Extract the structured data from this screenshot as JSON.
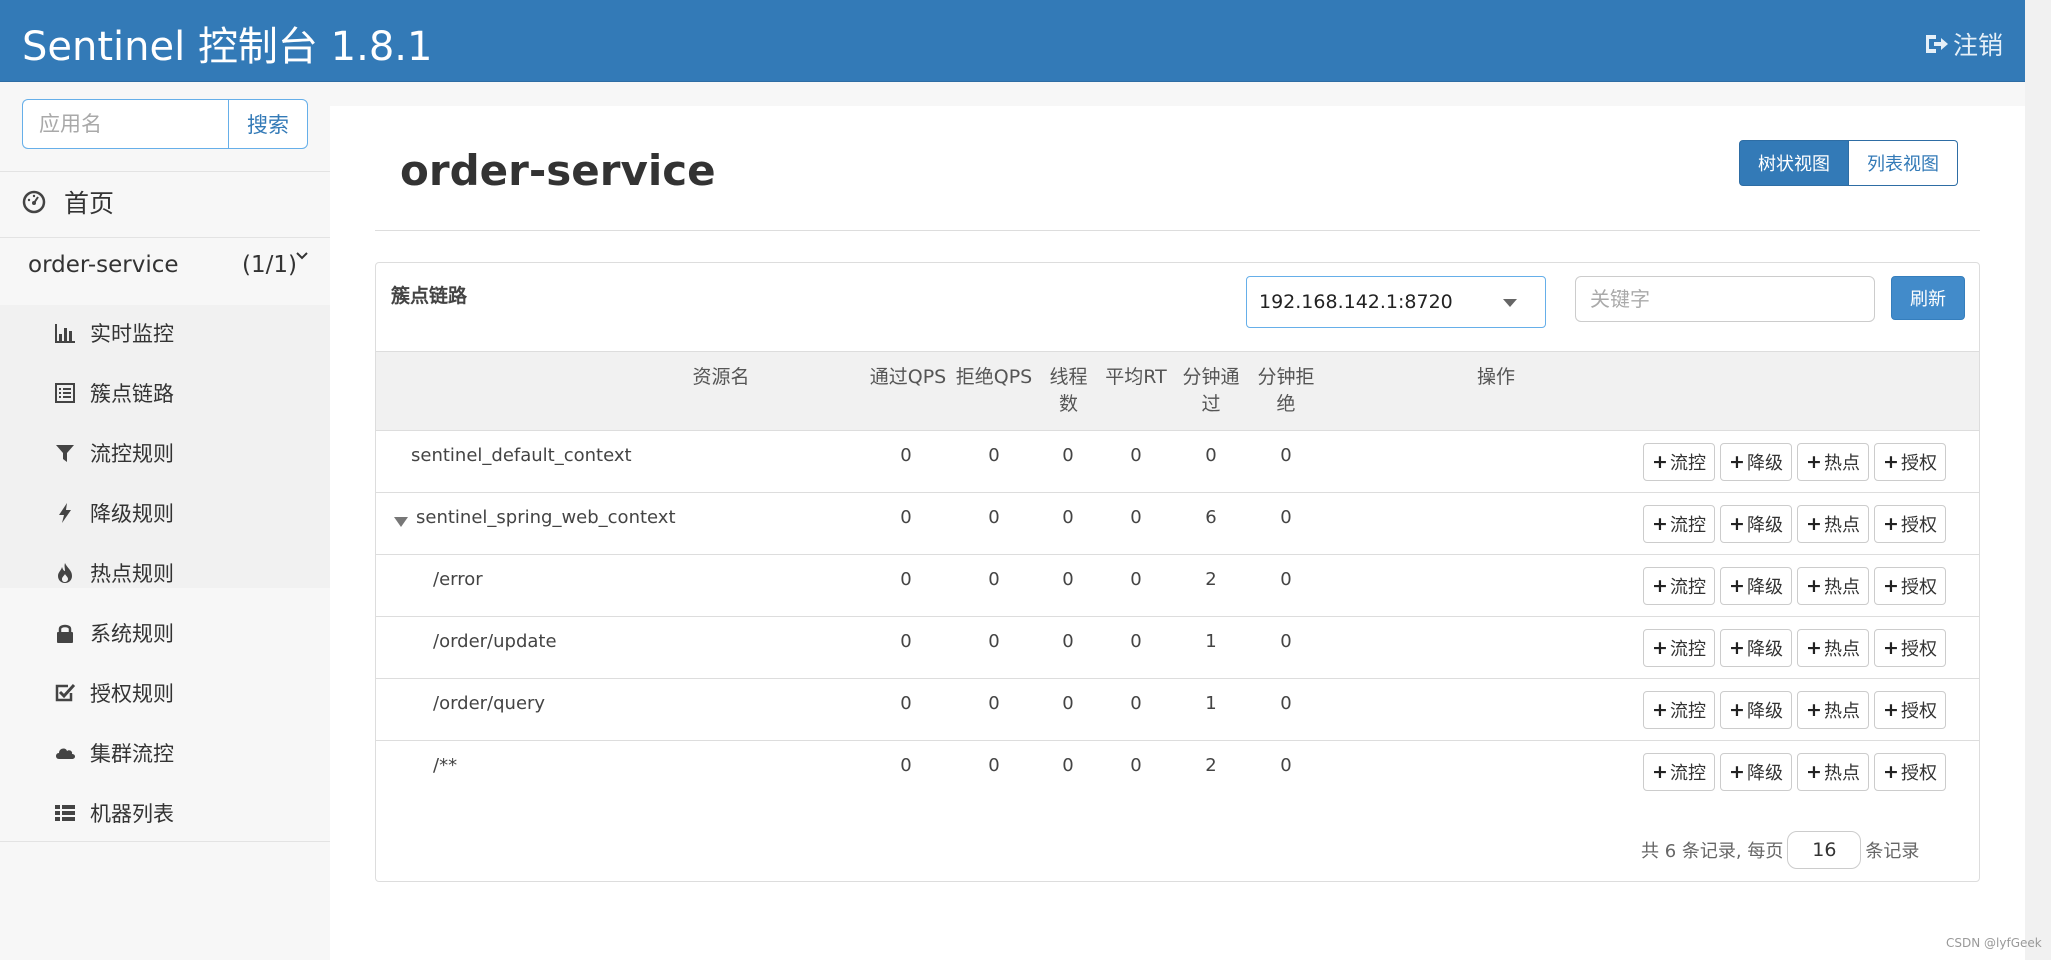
{
  "header": {
    "brand": "Sentinel 控制台 1.8.1",
    "logout_label": "注销"
  },
  "sidebar": {
    "search_placeholder": "应用名",
    "search_button": "搜索",
    "home_label": "首页",
    "app_name": "order-service",
    "app_count": "(1/1)",
    "menu_items": [
      {
        "label": "实时监控",
        "icon": "bar-chart-icon"
      },
      {
        "label": "簇点链路",
        "icon": "list-alt-icon"
      },
      {
        "label": "流控规则",
        "icon": "filter-icon"
      },
      {
        "label": "降级规则",
        "icon": "flash-icon"
      },
      {
        "label": "热点规则",
        "icon": "fire-icon"
      },
      {
        "label": "系统规则",
        "icon": "lock-icon"
      },
      {
        "label": "授权规则",
        "icon": "check-icon"
      },
      {
        "label": "集群流控",
        "icon": "cloud-icon"
      },
      {
        "label": "机器列表",
        "icon": "th-list-icon"
      }
    ]
  },
  "main": {
    "title": "order-service",
    "view_tree": "树状视图",
    "view_list": "列表视图",
    "panel_title": "簇点链路",
    "machine_value": "192.168.142.1:8720",
    "keyword_placeholder": "关键字",
    "refresh_label": "刷新",
    "columns": [
      "资源名",
      "通过QPS",
      "拒绝QPS",
      "线程数",
      "平均RT",
      "分钟通过",
      "分钟拒绝",
      "操作"
    ],
    "column_lines": {
      "thread": [
        "线程",
        "数"
      ],
      "min_pass": [
        "分钟通",
        "过"
      ],
      "min_block": [
        "分钟拒",
        "绝"
      ]
    },
    "rows": [
      {
        "name": "sentinel_default_context",
        "pass_qps": "0",
        "block_qps": "0",
        "threads": "0",
        "avg_rt": "0",
        "min_pass": "0",
        "min_block": "0"
      },
      {
        "name": "sentinel_spring_web_context",
        "pass_qps": "0",
        "block_qps": "0",
        "threads": "0",
        "avg_rt": "0",
        "min_pass": "6",
        "min_block": "0"
      },
      {
        "name": "/error",
        "pass_qps": "0",
        "block_qps": "0",
        "threads": "0",
        "avg_rt": "0",
        "min_pass": "2",
        "min_block": "0"
      },
      {
        "name": "/order/update",
        "pass_qps": "0",
        "block_qps": "0",
        "threads": "0",
        "avg_rt": "0",
        "min_pass": "1",
        "min_block": "0"
      },
      {
        "name": "/order/query",
        "pass_qps": "0",
        "block_qps": "0",
        "threads": "0",
        "avg_rt": "0",
        "min_pass": "1",
        "min_block": "0"
      },
      {
        "name": "/**",
        "pass_qps": "0",
        "block_qps": "0",
        "threads": "0",
        "avg_rt": "0",
        "min_pass": "2",
        "min_block": "0"
      }
    ],
    "op_buttons": [
      "流控",
      "降级",
      "热点",
      "授权"
    ],
    "pager_prefix": "共 6 条记录, 每页",
    "page_size": "16",
    "pager_suffix": "条记录"
  },
  "watermark": "CSDN @lyfGeek"
}
